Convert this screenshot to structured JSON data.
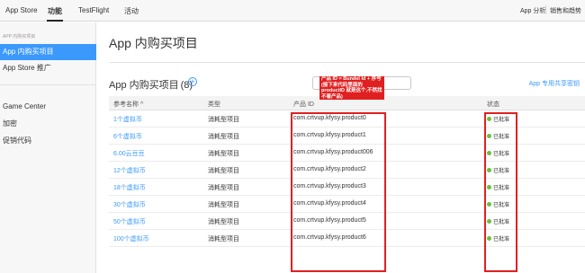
{
  "topnav": {
    "tabs": [
      {
        "label": "App Store"
      },
      {
        "label": "功能"
      },
      {
        "label": "TestFlight"
      },
      {
        "label": "活动"
      }
    ],
    "right_links": [
      {
        "label": "App 分析"
      },
      {
        "label": "销售和趋势"
      }
    ]
  },
  "sidebar": {
    "section_label": "APP 内购买项目",
    "items": [
      {
        "label": "App 内购买项目"
      },
      {
        "label": "App Store 推广"
      },
      {
        "label": "Game Center"
      },
      {
        "label": "加密"
      },
      {
        "label": "促销代码"
      }
    ]
  },
  "main": {
    "page_title": "App 内购买项目",
    "section_title": "App 内购买项目",
    "section_count": "(8)",
    "add_icon_glyph": "+",
    "shared_secret_link": "App 专用共享密钥",
    "annotation_text": "产品 ID = Bundel Id + 序号 (接下来代码里面的 productID 就是这个,不然找不着产品)",
    "columns": {
      "name": "参考名称 ^",
      "type": "类型",
      "product_id": "产品 ID",
      "status": "状态"
    },
    "rows": [
      {
        "name": "1个虚拟币",
        "type": "消耗型项目",
        "product_id": "com.crtvup.kfysy.product0",
        "status": "已批准"
      },
      {
        "name": "6个虚拟币",
        "type": "消耗型项目",
        "product_id": "com.crtvup.kfysy.product1",
        "status": "已批准"
      },
      {
        "name": "6.00云豆豆",
        "type": "消耗型项目",
        "product_id": "com.crtvup.kfysy.product006",
        "status": "已批准"
      },
      {
        "name": "12个虚拟币",
        "type": "消耗型项目",
        "product_id": "com.crtvup.kfysy.product2",
        "status": "已批准"
      },
      {
        "name": "18个虚拟币",
        "type": "消耗型项目",
        "product_id": "com.crtvup.kfysy.product3",
        "status": "已批准"
      },
      {
        "name": "30个虚拟币",
        "type": "消耗型项目",
        "product_id": "com.crtvup.kfysy.product4",
        "status": "已批准"
      },
      {
        "name": "50个虚拟币",
        "type": "消耗型项目",
        "product_id": "com.crtvup.kfysy.product5",
        "status": "已批准"
      },
      {
        "name": "100个虚拟币",
        "type": "消耗型项目",
        "product_id": "com.crtvup.kfysy.product6",
        "status": "已批准"
      }
    ]
  },
  "colors": {
    "accent": "#3b99fc",
    "annotation_red": "#e02020",
    "approved_green": "#6cbf3c"
  }
}
